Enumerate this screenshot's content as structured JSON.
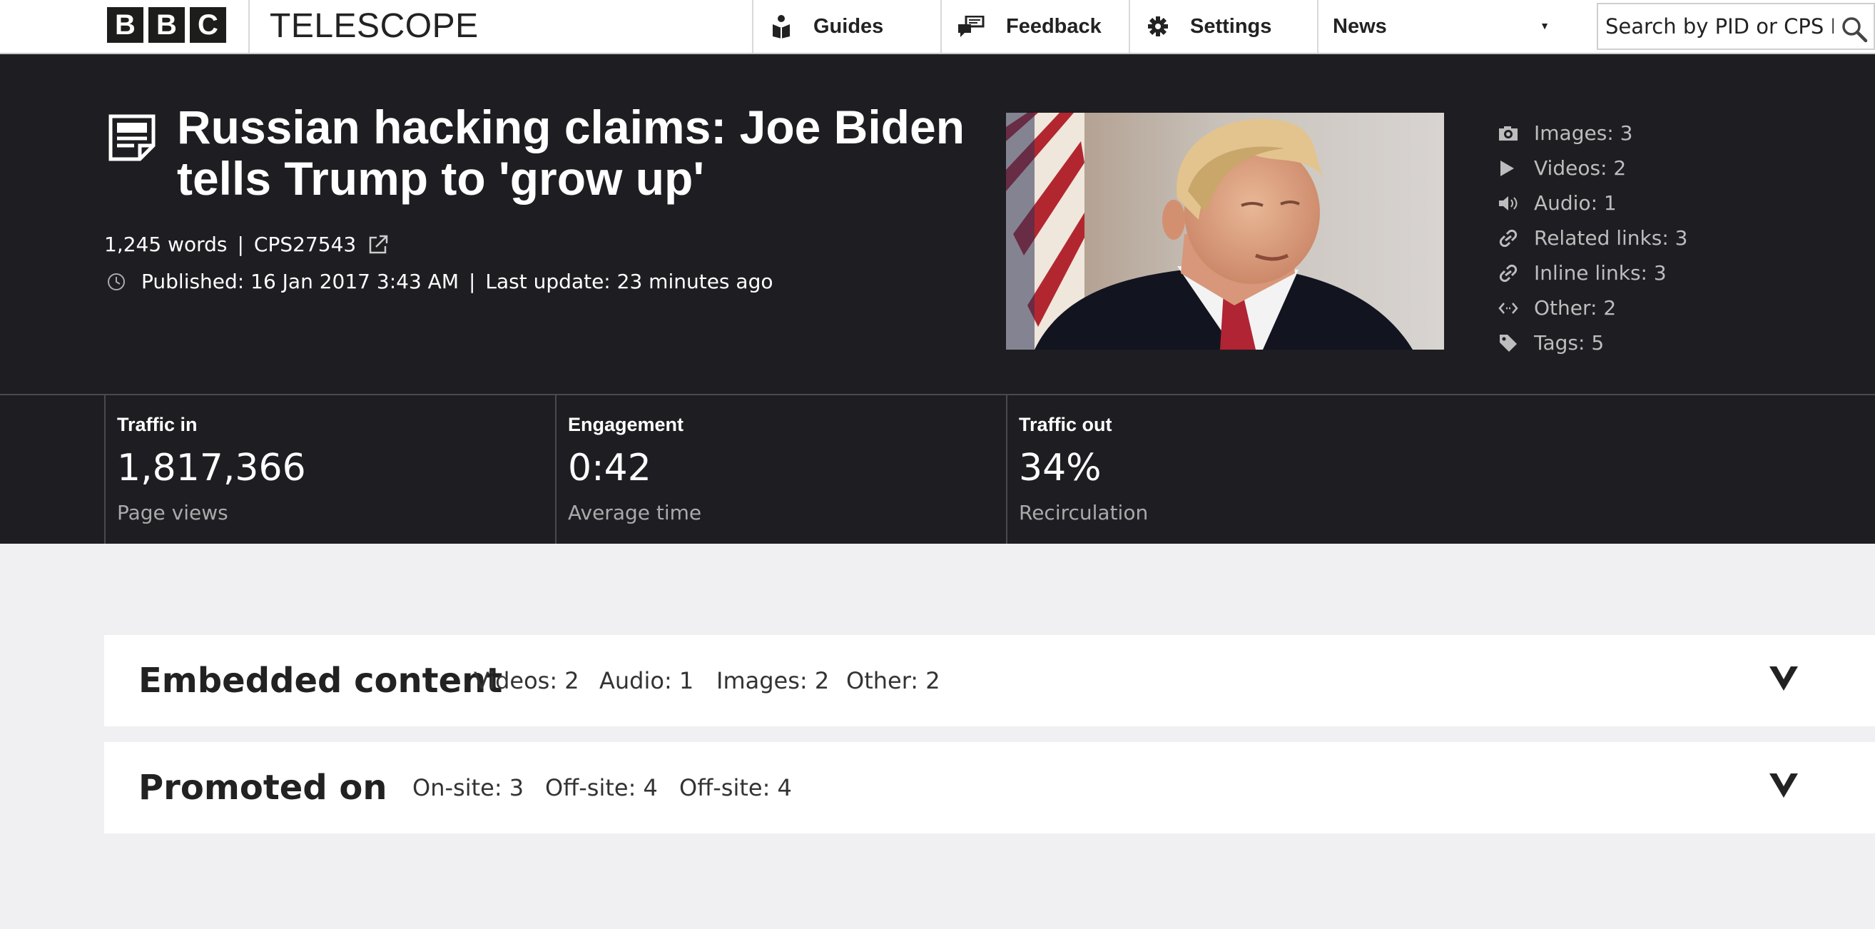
{
  "nav": {
    "logo_letters": [
      "B",
      "B",
      "C"
    ],
    "app_title": "TELESCOPE",
    "guides": "Guides",
    "feedback": "Feedback",
    "settings": "Settings",
    "news_selected": "News",
    "search_placeholder": "Search by PID or CPS ID",
    "icons": [
      "guides-icon",
      "feedback-icon",
      "gear-icon",
      "search-icon"
    ]
  },
  "article": {
    "headline": "Russian hacking claims: Joe Biden tells Trump to 'grow up'",
    "words": "1,245 words",
    "cps_id": "CPS27543",
    "published": "Published: 16 Jan 2017 3:43 AM",
    "last_update": "Last update: 23 minutes ago"
  },
  "counts": [
    {
      "icon": "camera-icon",
      "label": "Images: 3"
    },
    {
      "icon": "play-icon",
      "label": "Videos: 2"
    },
    {
      "icon": "speaker-icon",
      "label": "Audio: 1"
    },
    {
      "icon": "link-icon",
      "label": "Related links: 3"
    },
    {
      "icon": "link-icon",
      "label": "Inline links: 3"
    },
    {
      "icon": "code-icon",
      "label": "Other: 2"
    },
    {
      "icon": "tag-icon",
      "label": "Tags: 5"
    }
  ],
  "stats": [
    {
      "label": "Traffic in",
      "value": "1,817,366",
      "sub": "Page views"
    },
    {
      "label": "Engagement",
      "value": "0:42",
      "sub": "Average time"
    },
    {
      "label": "Traffic out",
      "value": "34%",
      "sub": "Recirculation"
    }
  ],
  "embedded": {
    "title": "Embedded content",
    "items": [
      "Videos: 2",
      "Audio: 1",
      "Images: 2",
      "Other: 2"
    ]
  },
  "promoted": {
    "title": "Promoted on",
    "items": [
      "On-site: 3",
      "Off-site: 4",
      "Off-site: 4"
    ]
  },
  "colors": {
    "hero_bg": "#1e1d22",
    "page_bg": "#f0f0f2",
    "muted": "#bdbdbd"
  }
}
